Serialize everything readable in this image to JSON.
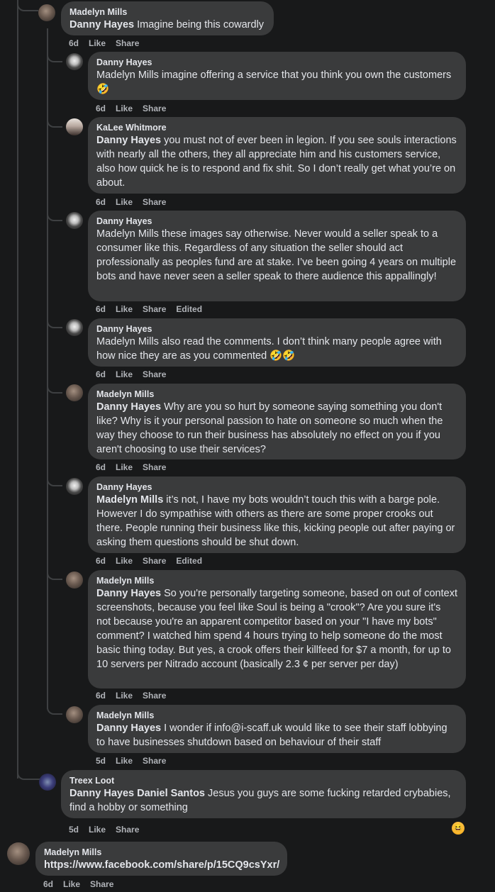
{
  "comments": [
    {
      "author": "Madelyn Mills",
      "mention": "Danny Hayes",
      "text": " Imagine being this cowardly",
      "time": "6d",
      "like": "Like",
      "share": "Share"
    },
    {
      "author": "Danny Hayes",
      "mention": "",
      "text": "Madelyn Mills imagine offering a service that you think you own the customers 🤣",
      "time": "6d",
      "like": "Like",
      "share": "Share"
    },
    {
      "author": "KaLee Whitmore",
      "mention": "Danny Hayes",
      "text": " you must not of ever been in legion. If you see souls interactions with nearly all the others, they all appreciate him and his customers service, also how quick he is to respond and fix shit. So I don’t really get what you’re on about.",
      "time": "6d",
      "like": "Like",
      "share": "Share"
    },
    {
      "author": "Danny Hayes",
      "mention": "",
      "text": "Madelyn Mills these images say otherwise. Never would a seller speak to a consumer like this. Regardless of any situation the seller should act professionally as peoples fund are at stake. I’ve been going 4 years on multiple bots and have never seen a seller speak to there audience this appallingly!",
      "time": "6d",
      "like": "Like",
      "share": "Share",
      "edited": "Edited"
    },
    {
      "author": "Danny Hayes",
      "mention": "",
      "text": "Madelyn Mills also read the comments. I don’t think many people agree with how nice they are as you commented 🤣🤣",
      "time": "6d",
      "like": "Like",
      "share": "Share"
    },
    {
      "author": "Madelyn Mills",
      "mention": "Danny Hayes",
      "text": " Why are you so hurt by someone saying something you don't like? Why is it your personal passion to hate on someone so much when the way they choose to run their business has absolutely no effect on you if you aren't choosing to use their services?",
      "time": "6d",
      "like": "Like",
      "share": "Share"
    },
    {
      "author": "Danny Hayes",
      "mention": "Madelyn Mills",
      "text": " it’s not, I have my bots wouldn’t touch this with a barge pole. However I do sympathise with others as there are some proper crooks out there. People running their business like this, kicking people out after paying or asking them questions should be shut down.",
      "time": "6d",
      "like": "Like",
      "share": "Share",
      "edited": "Edited"
    },
    {
      "author": "Madelyn Mills",
      "mention": "Danny Hayes",
      "text": " So you're personally targeting someone, based on out of context screenshots, because you feel like Soul is being a \"crook\"? Are you sure it's not because you're an apparent competitor based on your \"I have my bots\" comment? I watched him spend 4 hours trying to help someone do the most basic thing today. But yes, a crook offers their killfeed for $7 a month, for up to 10 servers per Nitrado account (basically 2.3 ¢ per server per day)",
      "time": "6d",
      "like": "Like",
      "share": "Share"
    },
    {
      "author": "Madelyn Mills",
      "mention": "Danny Hayes",
      "text": " I wonder if info@i-scaff.uk would like to see their staff lobbying to have businesses shutdown based on behaviour of their staff",
      "time": "5d",
      "like": "Like",
      "share": "Share"
    },
    {
      "author": "Treex Loot",
      "mention": "Danny Hayes Daniel Santos",
      "text": " Jesus you guys are some fucking retarded crybabies, find a hobby or something",
      "time": "5d",
      "like": "Like",
      "share": "Share"
    },
    {
      "author": "Madelyn Mills",
      "mention": "",
      "text": "https://www.facebook.com/share/p/15CQ9csYxr/",
      "time": "6d",
      "like": "Like",
      "share": "Share"
    }
  ],
  "reaction": {
    "icon": "laughing-emoji-icon",
    "glyph": "😆"
  }
}
